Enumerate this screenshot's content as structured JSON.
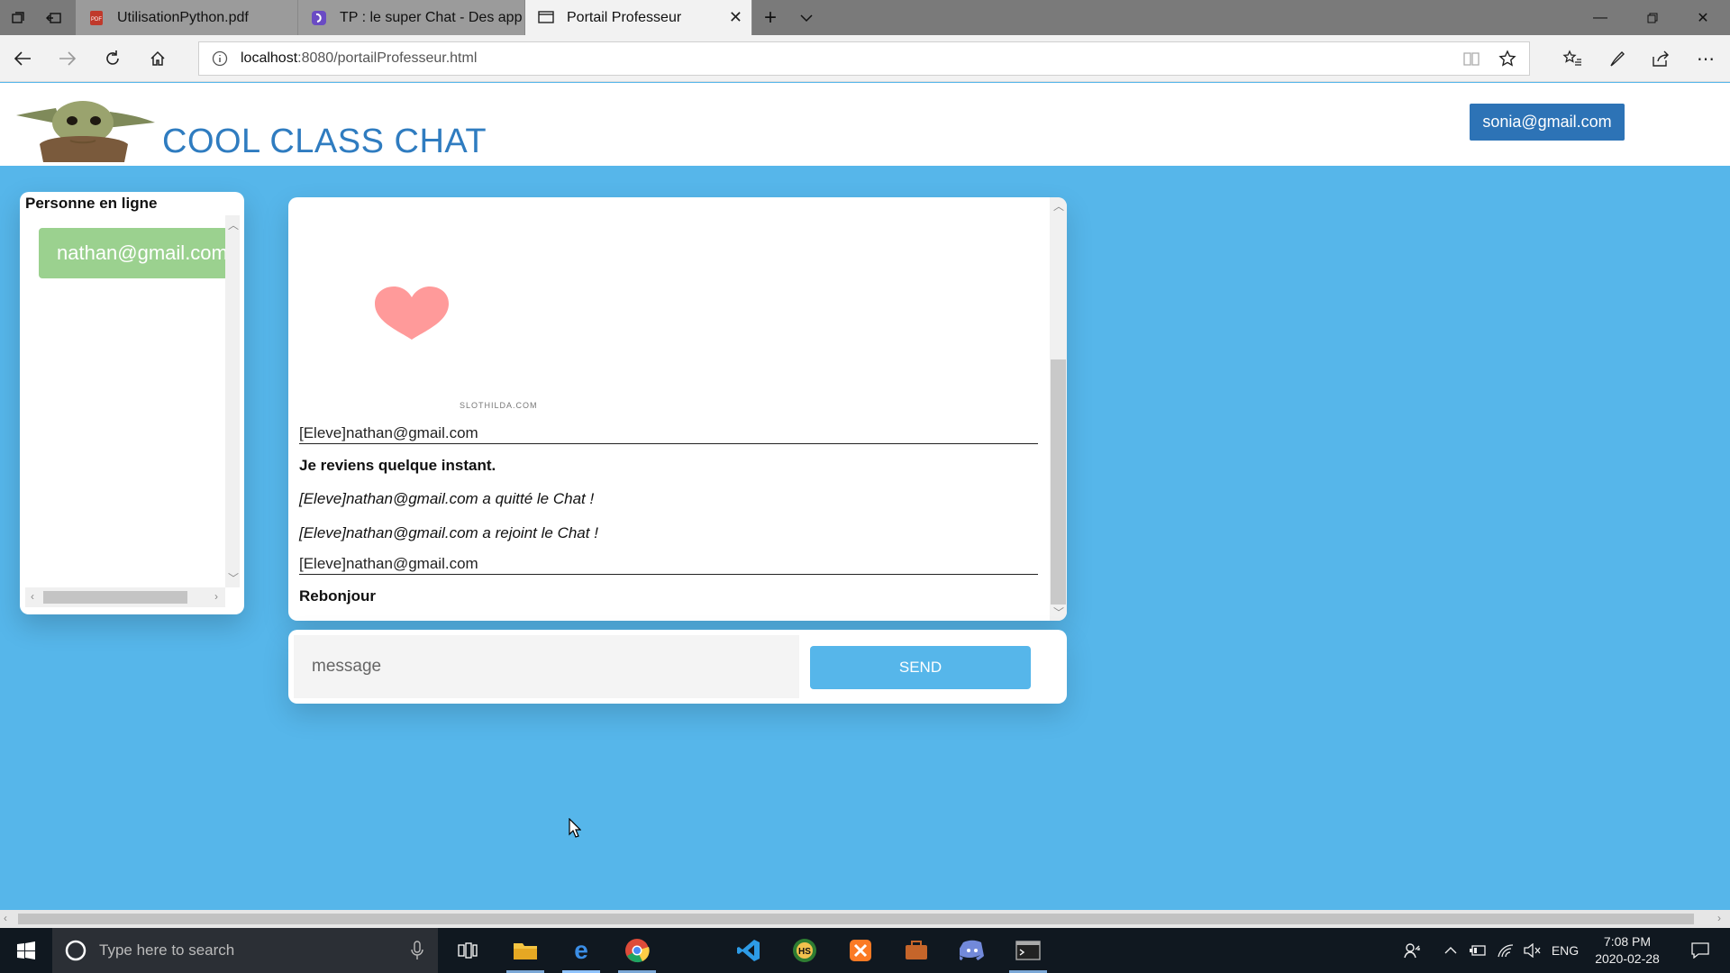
{
  "browser": {
    "tabs": [
      {
        "title": "UtilisationPython.pdf",
        "active": false,
        "icon": "pdf-icon"
      },
      {
        "title": "TP : le super Chat - Des app",
        "active": false,
        "icon": "site-icon"
      },
      {
        "title": "Portail Professeur",
        "active": true,
        "icon": "page-icon"
      }
    ],
    "url_host": "localhost",
    "url_rest": ":8080/portailProfesseur.html"
  },
  "header": {
    "title": "COOL CLASS CHAT",
    "user_email": "sonia@gmail.com",
    "logo": "baby-yoda-logo"
  },
  "online": {
    "title": "Personne en ligne",
    "users": [
      "nathan@gmail.com"
    ]
  },
  "chat": {
    "gif_caption": "SLOTHILDA.COM",
    "messages": [
      {
        "type": "sender",
        "text": "[Eleve]nathan@gmail.com"
      },
      {
        "type": "body",
        "text": "Je reviens quelque instant."
      },
      {
        "type": "notice",
        "text": "[Eleve]nathan@gmail.com a quitté le Chat !"
      },
      {
        "type": "notice",
        "text": "[Eleve]nathan@gmail.com a rejoint le Chat !"
      },
      {
        "type": "sender",
        "text": "[Eleve]nathan@gmail.com"
      },
      {
        "type": "body",
        "text": "Rebonjour"
      }
    ]
  },
  "composer": {
    "placeholder": "message",
    "send_label": "SEND"
  },
  "taskbar": {
    "search_placeholder": "Type here to search",
    "language": "ENG",
    "time": "7:08 PM",
    "date": "2020-02-28"
  },
  "colors": {
    "page_background": "#56b6ea",
    "title_blue": "#2f7cc0",
    "user_button": "#2d73b6",
    "online_chip": "#9bd18f",
    "send_button": "#56b6ea",
    "heart": "#ff9a9a"
  }
}
